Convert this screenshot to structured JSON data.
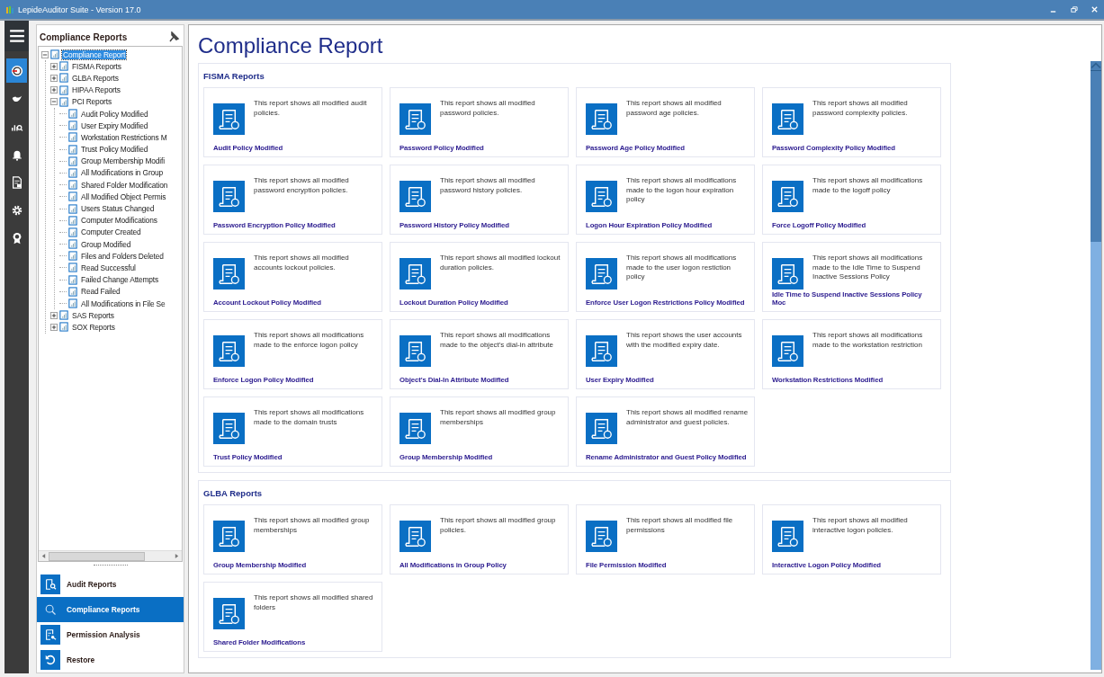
{
  "window": {
    "title": "LepideAuditor Suite - Version 17.0"
  },
  "rail": [
    {
      "selected": false
    },
    {
      "selected": true
    },
    {
      "selected": false
    },
    {
      "selected": false
    },
    {
      "selected": false
    },
    {
      "selected": false
    },
    {
      "selected": false
    },
    {
      "selected": false
    }
  ],
  "panel": {
    "title": "Compliance Reports",
    "tree": [
      {
        "label": "Compliance Report",
        "selected": true,
        "expanded": true,
        "children": [
          {
            "label": "FISMA Reports",
            "selected": false,
            "expanded": false
          },
          {
            "label": "GLBA Reports",
            "selected": false,
            "expanded": false
          },
          {
            "label": "HIPAA Reports",
            "selected": false,
            "expanded": false
          },
          {
            "label": "PCI Reports",
            "selected": false,
            "expanded": true,
            "children": [
              {
                "label": "Audit Policy Modified",
                "selected": false
              },
              {
                "label": "User Expiry Modified",
                "selected": false
              },
              {
                "label": "Workstation Restrictions M",
                "selected": false
              },
              {
                "label": "Trust Policy Modified",
                "selected": false
              },
              {
                "label": "Group Membership Modifi",
                "selected": false
              },
              {
                "label": "All Modifications in  Group",
                "selected": false
              },
              {
                "label": "Shared Folder Modification",
                "selected": false
              },
              {
                "label": "All Modified Object Permis",
                "selected": false
              },
              {
                "label": "Users Status Changed",
                "selected": false
              },
              {
                "label": "Computer Modifications",
                "selected": false
              },
              {
                "label": "Computer Created",
                "selected": false
              },
              {
                "label": "Group Modified",
                "selected": false
              },
              {
                "label": "Files and Folders Deleted",
                "selected": false
              },
              {
                "label": "Read Successful",
                "selected": false
              },
              {
                "label": "Failed Change Attempts",
                "selected": false
              },
              {
                "label": "Read Failed",
                "selected": false
              },
              {
                "label": "All Modifications in File Se",
                "selected": false
              }
            ]
          },
          {
            "label": "SAS Reports",
            "selected": false,
            "expanded": false
          },
          {
            "label": "SOX Reports",
            "selected": false,
            "expanded": false
          }
        ]
      }
    ]
  },
  "nav": [
    {
      "label": "Audit Reports",
      "selected": false
    },
    {
      "label": "Compliance Reports",
      "selected": true
    },
    {
      "label": "Permission Analysis",
      "selected": false
    },
    {
      "label": "Restore",
      "selected": false
    }
  ],
  "main": {
    "title": "Compliance Report",
    "sections": [
      {
        "title": "FISMA Reports",
        "reports": [
          {
            "description": "This report shows all modified audit policies.",
            "title": "Audit Policy Modified"
          },
          {
            "description": "This report shows all modified password policies.",
            "title": "Password Policy Modified"
          },
          {
            "description": "This report shows all modified password age policies.",
            "title": "Password Age Policy Modified"
          },
          {
            "description": "This report shows all modified password complexity policies.",
            "title": "Password Complexity Policy Modified"
          },
          {
            "description": "This report shows all modified password encryption policies.",
            "title": "Password Encryption Policy Modified"
          },
          {
            "description": "This report shows all modified password history policies.",
            "title": "Password History Policy Modified"
          },
          {
            "description": "This report shows  all modifications made to the logon hour expiration policy",
            "title": "Logon Hour Expiration Policy Modified"
          },
          {
            "description": "This report shows  all modifications made to the logoff policy",
            "title": "Force Logoff Policy Modified"
          },
          {
            "description": "This report shows all modified accounts lockout policies.",
            "title": "Account Lockout Policy Modified"
          },
          {
            "description": "This report shows all modified lockout duration policies.",
            "title": "Lockout Duration Policy Modified"
          },
          {
            "description": "This report shows  all modifications made to the user logon restiction policy",
            "title": "Enforce User Logon Restrictions Policy Modified"
          },
          {
            "description": "This report shows  all modifications made to the Idle Time to Suspend Inactive Sessions Policy",
            "title": "Idle Time to Suspend Inactive Sessions Policy Moc"
          },
          {
            "description": "This report shows  all modifications made to the enforce logon policy",
            "title": "Enforce Logon Policy Modified"
          },
          {
            "description": "This report shows  all modifications made to the object's dial-in attribute",
            "title": "Object's Dial-In Attribute Modified"
          },
          {
            "description": "This report shows the user accounts with the modified expiry date.",
            "title": "User Expiry Modified"
          },
          {
            "description": "This report shows  all modifications made to the workstation restriction",
            "title": "Workstation Restrictions Modified"
          },
          {
            "description": "This report shows all modifications made to the domain trusts",
            "title": "Trust Policy Modified"
          },
          {
            "description": "This report shows all modified group memberships",
            "title": "Group Membership Modified"
          },
          {
            "description": "This report shows all modified rename administrator and guest policies.",
            "title": "Rename Administrator and Guest Policy Modified"
          }
        ]
      },
      {
        "title": "GLBA Reports",
        "reports": [
          {
            "description": "This report shows all modified group memberships",
            "title": "Group Membership Modified"
          },
          {
            "description": "This report shows all modified group policies.",
            "title": "All Modifications in  Group Policy"
          },
          {
            "description": "This report shows all modified file permissions",
            "title": "File Permission Modified"
          },
          {
            "description": "This report shows all modified interactive logon policies.",
            "title": "Interactive Logon Policy Modified"
          },
          {
            "description": "This report shows all modified shared folders",
            "title": "Shared Folder Modifications"
          }
        ]
      }
    ]
  }
}
